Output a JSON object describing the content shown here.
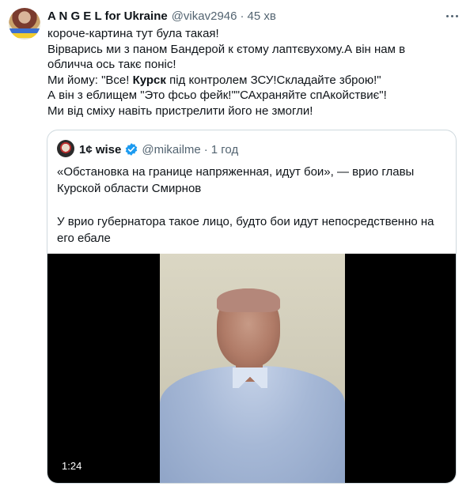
{
  "tweet": {
    "author_name": "A N G E L for Ukraine",
    "author_handle": "@vikav2946",
    "separator": "·",
    "time": "45 хв",
    "lines": [
      "короче-картина тут була такая!",
      "Вірварись ми з паном Бандерой к єтому лаптєвухому.А він нам в",
      "обличча ось такє поніс!",
      "А він з  еблищем \"Это фсьо фейк!\"\"САхраняйте спАкойствиє\"!",
      "Ми від сміху навіть пристрелити його не змогли!"
    ],
    "line4": {
      "before": "Ми йому: \"Все! ",
      "bold": "Курск",
      "after": " під контролем ЗСУ!Складайте зброю!\""
    }
  },
  "quote": {
    "author_name": "1¢ wise",
    "author_handle": "@mikailme",
    "separator": "·",
    "time": "1 год",
    "paragraph1": [
      "«Обстановка на границе напряженная, идут бои», — врио главы",
      "Курской области Смирнов"
    ],
    "paragraph2": [
      "У врио губернатора такое лицо, будто бои идут непосредственно на",
      "его ебале"
    ],
    "video": {
      "duration": "1:24"
    }
  },
  "colors": {
    "text_primary": "#0f1419",
    "text_secondary": "#536471",
    "verified_blue": "#1d9bf0",
    "border": "#cfd9de"
  },
  "icons": {
    "more": "more-horizontal-icon",
    "verified": "verified-badge-icon"
  }
}
